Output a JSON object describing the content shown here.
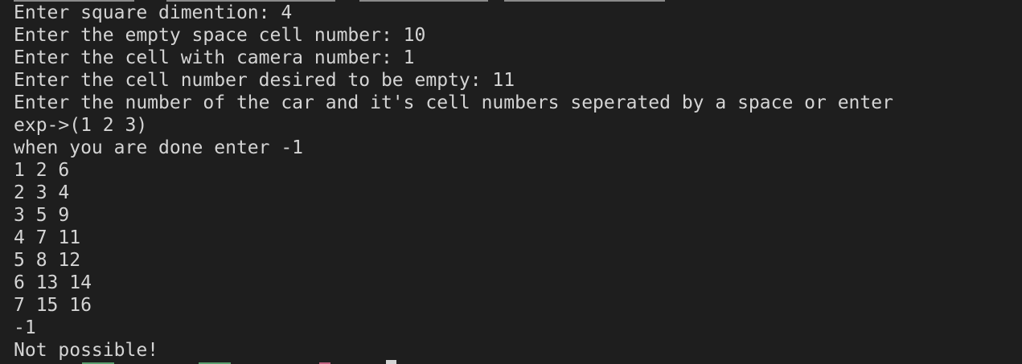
{
  "terminal": {
    "lines": [
      "Enter square dimention: 4",
      "Enter the empty space cell number: 10",
      "Enter the cell with camera number: 1",
      "Enter the cell number desired to be empty: 11",
      "Enter the number of the car and it's cell numbers seperated by a space or enter",
      "exp->(1 2 3)",
      "when you are done enter -1",
      "1 2 6",
      "2 3 4",
      "3 5 9",
      "4 7 11",
      "5 8 12",
      "6 13 14",
      "7 15 16",
      "-1",
      "Not possible!"
    ]
  },
  "colors": {
    "background": "#1e1e1e",
    "foreground": "#d4d4d4"
  }
}
